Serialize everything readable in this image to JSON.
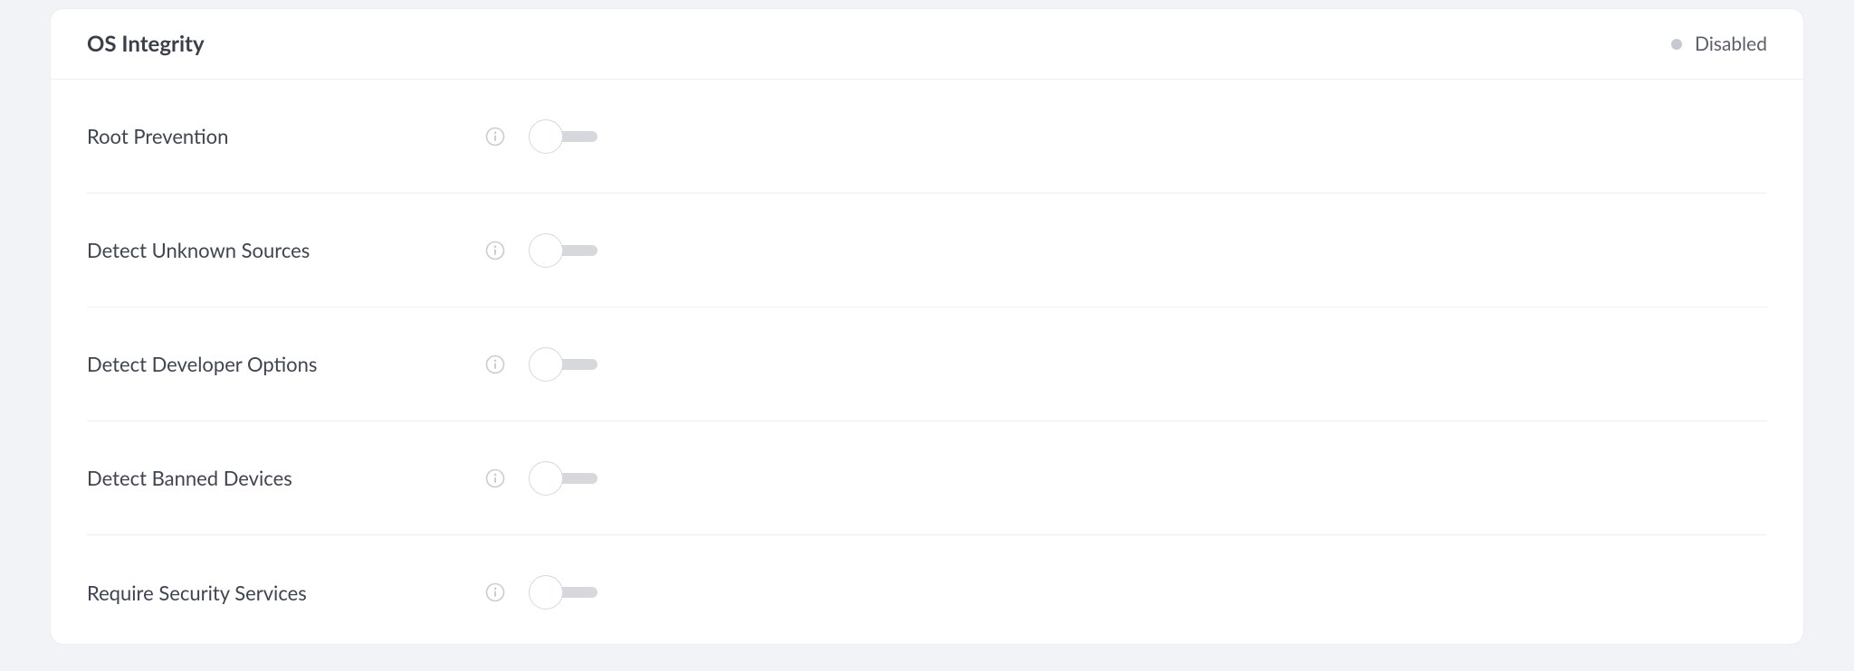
{
  "panel": {
    "title": "OS Integrity",
    "status_label": "Disabled",
    "status_color": "#c6c9cf"
  },
  "settings": [
    {
      "label": "Root Prevention",
      "enabled": false
    },
    {
      "label": "Detect Unknown Sources",
      "enabled": false
    },
    {
      "label": "Detect Developer Options",
      "enabled": false
    },
    {
      "label": "Detect Banned Devices",
      "enabled": false
    },
    {
      "label": "Require Security Services",
      "enabled": false
    }
  ]
}
